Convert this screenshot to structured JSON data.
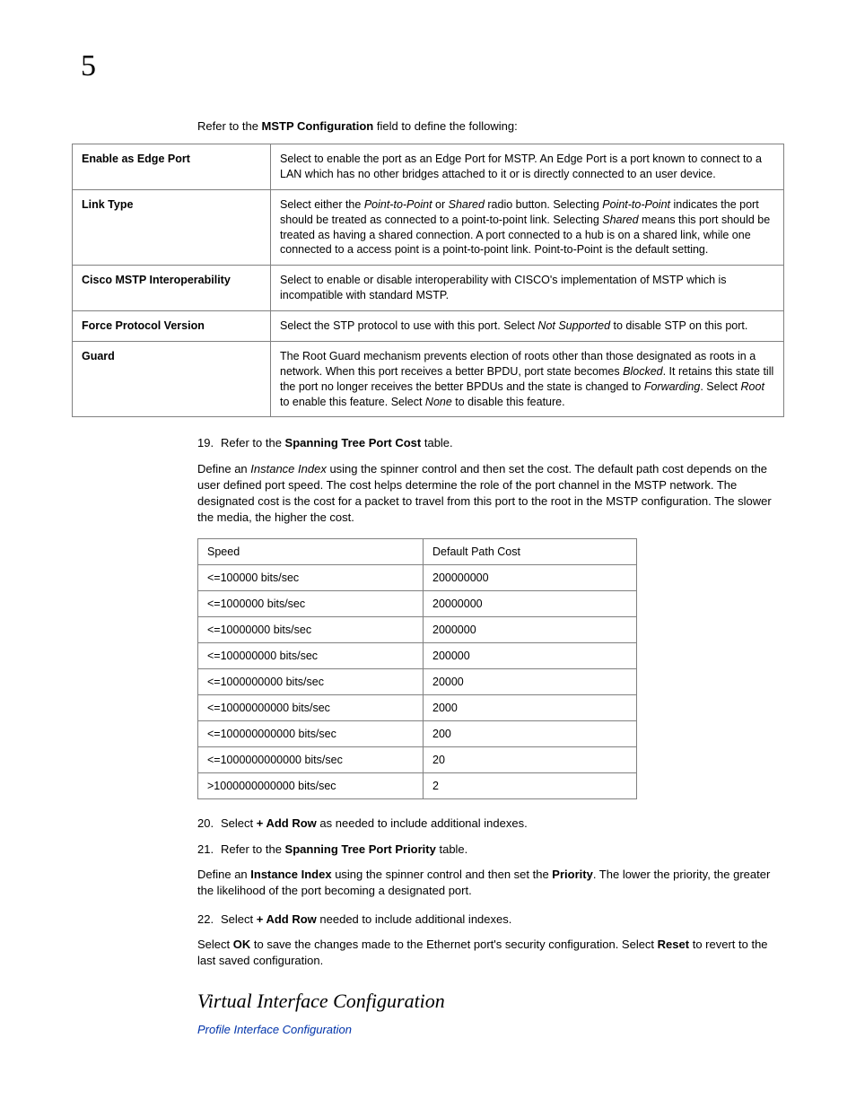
{
  "chapter": "5",
  "intro": {
    "prefix": "Refer to the ",
    "bold": "MSTP Configuration",
    "suffix": " field to define the following:"
  },
  "defs": [
    {
      "term": "Enable as Edge Port",
      "parts": [
        {
          "t": "Select to enable the port as an Edge Port for MSTP. An Edge Port is a port known to connect to a LAN which has no other bridges attached to it or is directly connected to an user device."
        }
      ]
    },
    {
      "term": "Link Type",
      "parts": [
        {
          "t": "Select either the "
        },
        {
          "t": "Point-to-Point",
          "i": true
        },
        {
          "t": " or "
        },
        {
          "t": "Shared",
          "i": true
        },
        {
          "t": " radio button. Selecting "
        },
        {
          "t": "Point-to-Point",
          "i": true
        },
        {
          "t": " indicates the port should be treated as connected to a point-to-point link. Selecting "
        },
        {
          "t": "Shared",
          "i": true
        },
        {
          "t": " means this port should be treated as having a shared connection. A port connected to a hub is on a shared link, while one connected to a access point is a point-to-point link. Point-to-Point is the default setting."
        }
      ]
    },
    {
      "term": "Cisco MSTP Interoperability",
      "parts": [
        {
          "t": "Select to enable or disable interoperability with CISCO's implementation of MSTP which is incompatible with standard MSTP."
        }
      ]
    },
    {
      "term": "Force Protocol Version",
      "parts": [
        {
          "t": "Select the STP protocol to use with this port. Select "
        },
        {
          "t": "Not Supported",
          "i": true
        },
        {
          "t": " to disable STP on this port."
        }
      ]
    },
    {
      "term": "Guard",
      "parts": [
        {
          "t": "The Root Guard mechanism prevents election of roots other than those designated as roots in a network. When this port receives a better BPDU, port state becomes "
        },
        {
          "t": "Blocked",
          "i": true
        },
        {
          "t": ". It retains this state till the port no longer receives the better BPDUs and the state is changed to "
        },
        {
          "t": "Forwarding",
          "i": true
        },
        {
          "t": ". Select "
        },
        {
          "t": "Root",
          "i": true
        },
        {
          "t": " to enable this feature. Select "
        },
        {
          "t": "None",
          "i": true
        },
        {
          "t": " to disable this feature."
        }
      ]
    }
  ],
  "step19": {
    "num": "19.",
    "prefix": "Refer to the ",
    "bold": "Spanning Tree Port Cost",
    "suffix": " table."
  },
  "para19": {
    "p1": "Define an ",
    "i1": "Instance Index",
    "p2": " using the spinner control and then set the cost. The default path cost depends on the user defined port speed. The cost helps determine the role of the port channel in the MSTP network. The designated cost is the cost for a packet to travel from this port to the root in the MSTP configuration. The slower the media, the higher the cost."
  },
  "chart_data": {
    "type": "table",
    "columns": [
      "Speed",
      "Default Path Cost"
    ],
    "rows": [
      [
        "<=100000 bits/sec",
        "200000000"
      ],
      [
        "<=1000000 bits/sec",
        "20000000"
      ],
      [
        "<=10000000 bits/sec",
        "2000000"
      ],
      [
        "<=100000000 bits/sec",
        "200000"
      ],
      [
        "<=1000000000 bits/sec",
        "20000"
      ],
      [
        "<=10000000000 bits/sec",
        "2000"
      ],
      [
        "<=100000000000 bits/sec",
        "200"
      ],
      [
        "<=1000000000000 bits/sec",
        "20"
      ],
      [
        ">1000000000000 bits/sec",
        "2"
      ]
    ]
  },
  "step20": {
    "num": "20.",
    "prefix": "Select ",
    "bold": "+ Add Row",
    "suffix": " as needed to include additional indexes."
  },
  "step21": {
    "num": "21.",
    "prefix": "Refer to the ",
    "bold": "Spanning Tree Port Priority",
    "suffix": " table."
  },
  "para21": {
    "p1": "Define an ",
    "b1": "Instance Index",
    "p2": " using the spinner control and then set the ",
    "b2": "Priority",
    "p3": ". The lower the priority, the greater the likelihood of the port becoming a designated port."
  },
  "step22": {
    "num": "22.",
    "prefix": "Select ",
    "bold": "+ Add Row",
    "suffix": " needed to include additional indexes."
  },
  "closing": {
    "p1": "Select ",
    "b1": "OK",
    "p2": " to save the changes made to the Ethernet port's security configuration. Select ",
    "b2": "Reset",
    "p3": " to revert to the last saved configuration."
  },
  "section_heading": "Virtual Interface Configuration",
  "link_text": "Profile Interface Configuration"
}
